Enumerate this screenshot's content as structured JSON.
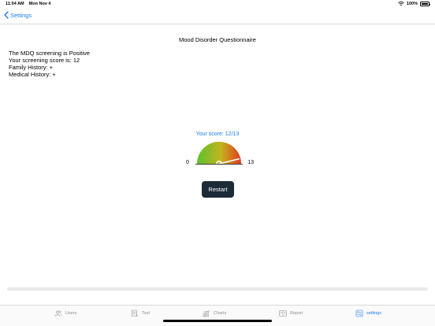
{
  "status_bar": {
    "time": "11:04 AM",
    "date": "Mon Nov 4",
    "battery": "100%",
    "icons": [
      "wifi-icon",
      "battery-icon"
    ]
  },
  "nav": {
    "back_label": "Settings",
    "back_icon": "chevron-left-icon"
  },
  "page": {
    "title": "Mood Disorder Questionnaire"
  },
  "result": {
    "screening": "The MDQ screening is Positive",
    "score_line": "Your screening score is: 12",
    "family_history": "Family History: +",
    "medical_history": "Medical History: +"
  },
  "gauge": {
    "caption": "Your score: 12/13",
    "min_label": "0",
    "max_label": "13",
    "value": 12,
    "max": 13,
    "colors": {
      "low": "#5cc32e",
      "mid": "#c4b21f",
      "high": "#e23a1f",
      "needle": "#ffffff"
    }
  },
  "actions": {
    "restart_label": "Restart"
  },
  "tabs": [
    {
      "label": "Users",
      "icon": "users-icon",
      "active": false
    },
    {
      "label": "Test",
      "icon": "test-icon",
      "active": false
    },
    {
      "label": "Charts",
      "icon": "charts-icon",
      "active": false
    },
    {
      "label": "Report",
      "icon": "report-icon",
      "active": false
    },
    {
      "label": "settings",
      "icon": "settings-icon",
      "active": true
    }
  ],
  "theme": {
    "accent": "#1a7cf4",
    "button_bg": "#1c2b38"
  }
}
